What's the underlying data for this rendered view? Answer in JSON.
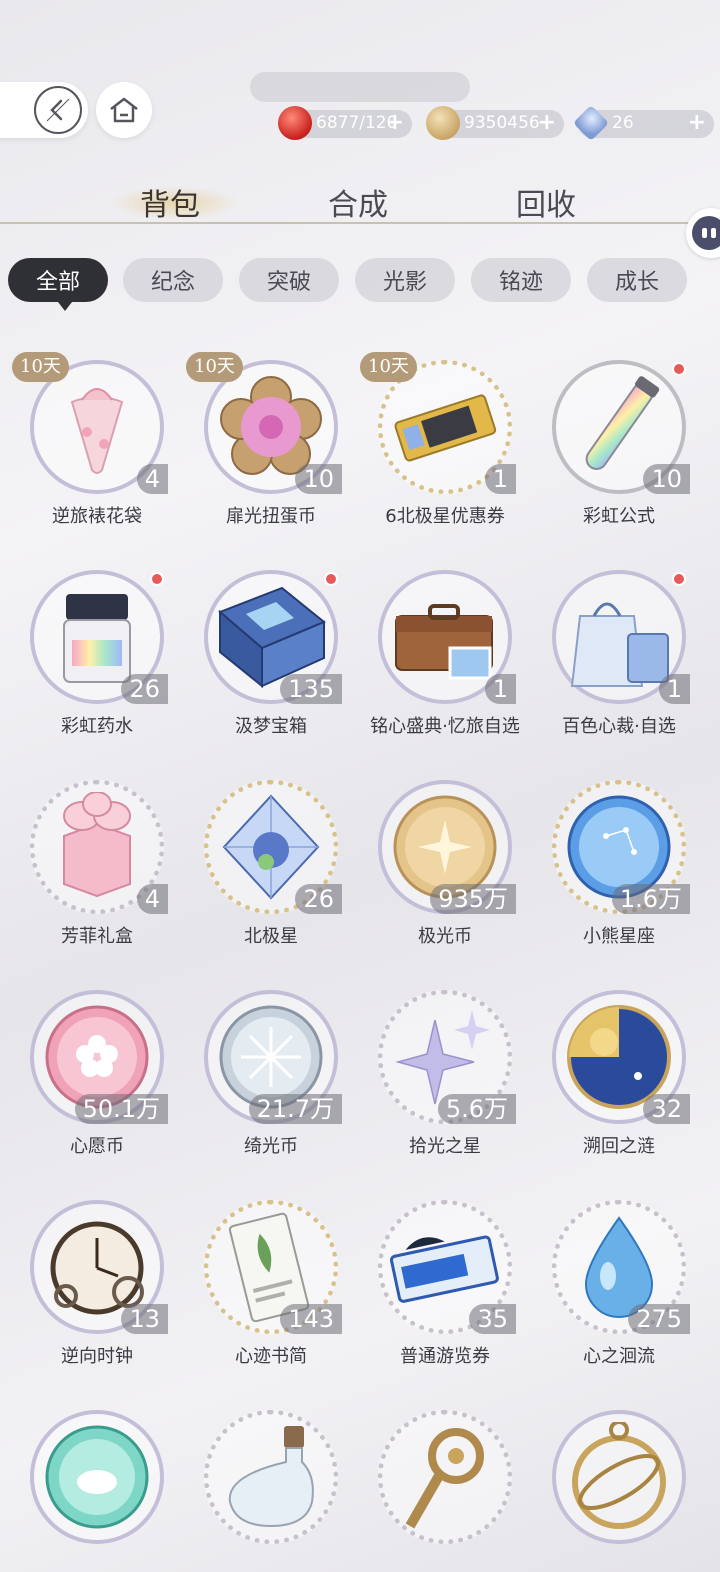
{
  "top_status": "",
  "resources": [
    {
      "icon": "apple-icon",
      "value": "6877/120",
      "plus": "+",
      "color": "#d83a34"
    },
    {
      "icon": "coin-icon",
      "value": "9350456",
      "plus": "+",
      "color": "#d9b878"
    },
    {
      "icon": "diamond-icon",
      "value": "26",
      "plus": "+",
      "color": "#7e9ad4"
    }
  ],
  "main_tabs": [
    {
      "label": "背包",
      "active": true
    },
    {
      "label": "合成",
      "active": false
    },
    {
      "label": "回收",
      "active": false
    }
  ],
  "filters": [
    {
      "label": "全部",
      "active": true
    },
    {
      "label": "纪念",
      "active": false
    },
    {
      "label": "突破",
      "active": false
    },
    {
      "label": "光影",
      "active": false
    },
    {
      "label": "铭迹",
      "active": false
    },
    {
      "label": "成长",
      "active": false
    }
  ],
  "items": [
    {
      "name": "逆旅裱花袋",
      "count": "4",
      "badge": "10天",
      "icon": "piping-bag-icon"
    },
    {
      "name": "扉光扭蛋币",
      "count": "10",
      "badge": "10天",
      "icon": "flower-token-icon"
    },
    {
      "name": "6北极星优惠券",
      "count": "1",
      "badge": "10天",
      "icon": "ticket-icon"
    },
    {
      "name": "彩虹公式",
      "count": "10",
      "badge": "",
      "icon": "rainbow-tube-icon",
      "dot": true
    },
    {
      "name": "彩虹药水",
      "count": "26",
      "badge": "",
      "icon": "rainbow-jar-icon",
      "dot": true
    },
    {
      "name": "汲梦宝箱",
      "count": "135",
      "badge": "",
      "icon": "treasure-box-icon",
      "dot": true
    },
    {
      "name": "铭心盛典·忆旅自选",
      "count": "1",
      "badge": "",
      "icon": "suitcase-icon"
    },
    {
      "name": "百色心裁·自选",
      "count": "1",
      "badge": "",
      "icon": "gift-bag-icon",
      "dot": true
    },
    {
      "name": "芳菲礼盒",
      "count": "4",
      "badge": "",
      "icon": "flower-box-icon"
    },
    {
      "name": "北极星",
      "count": "26",
      "badge": "",
      "icon": "crystal-icon"
    },
    {
      "name": "极光币",
      "count": "935万",
      "badge": "",
      "icon": "gold-coin-icon"
    },
    {
      "name": "小熊星座",
      "count": "1.6万",
      "badge": "",
      "icon": "blue-coin-icon"
    },
    {
      "name": "心愿币",
      "count": "50.1万",
      "badge": "",
      "icon": "pink-coin-icon"
    },
    {
      "name": "绮光币",
      "count": "21.7万",
      "badge": "",
      "icon": "silver-coin-icon"
    },
    {
      "name": "拾光之星",
      "count": "5.6万",
      "badge": "",
      "icon": "sparkle-icon"
    },
    {
      "name": "溯回之涟",
      "count": "32",
      "badge": "",
      "icon": "sun-moon-coin-icon"
    },
    {
      "name": "逆向时钟",
      "count": "13",
      "badge": "",
      "icon": "clock-icon"
    },
    {
      "name": "心迹书简",
      "count": "143",
      "badge": "",
      "icon": "letter-card-icon"
    },
    {
      "name": "普通游览券",
      "count": "35",
      "badge": "",
      "icon": "ticket-orca-icon"
    },
    {
      "name": "心之洄流",
      "count": "275",
      "badge": "",
      "icon": "water-drop-icon"
    },
    {
      "name": "",
      "count": "",
      "badge": "",
      "icon": "candy-coin-icon"
    },
    {
      "name": "",
      "count": "",
      "badge": "",
      "icon": "moon-bottle-icon"
    },
    {
      "name": "",
      "count": "",
      "badge": "",
      "icon": "key-icon"
    },
    {
      "name": "",
      "count": "",
      "badge": "",
      "icon": "astrolabe-icon"
    }
  ]
}
